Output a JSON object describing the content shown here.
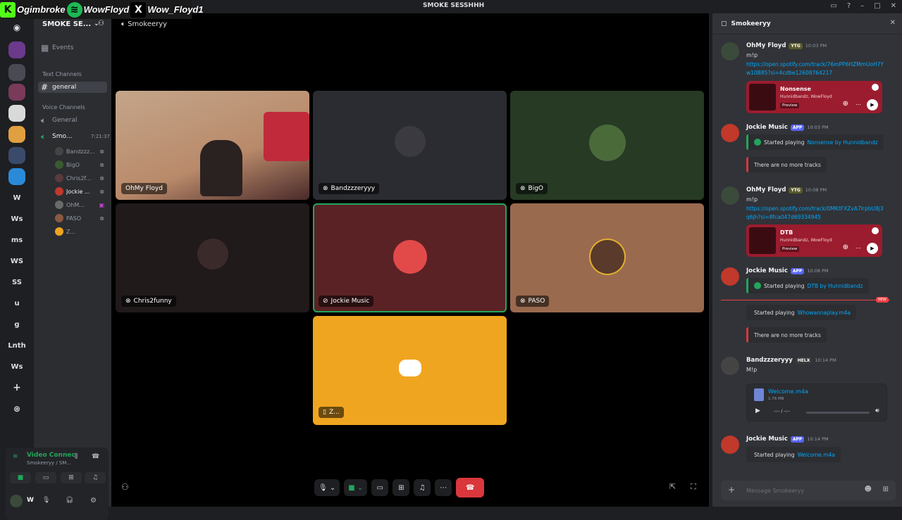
{
  "window": {
    "title": "SMOKE SESSHHH"
  },
  "overlay": [
    {
      "icon": "kick-icon",
      "text": "Ogimbroke"
    },
    {
      "icon": "spotify-icon",
      "text": "WowFloyd"
    },
    {
      "icon": "x-icon",
      "text": "Wow_Floyd1"
    }
  ],
  "servers": {
    "labels": [
      "W",
      "Ws",
      "ms",
      "WS",
      "SS",
      "u",
      "g",
      "Lnth",
      "Ws"
    ]
  },
  "sidebar": {
    "server_name": "SMOKE SE...",
    "events": "Events",
    "text_category": "Text Channels",
    "general_text": "general",
    "voice_category": "Voice Channels",
    "general_voice": "General",
    "active_voice": "Smo...",
    "active_voice_time": "7:21:37",
    "voice_users": [
      "Bandzzz...",
      "BigO",
      "Chris2f...",
      "Jockie ...",
      "OhM...",
      "PASO",
      "Z..."
    ]
  },
  "userpanel": {
    "status": "Video Connec",
    "sub": "Smokeeryy / SM...",
    "user": "W"
  },
  "stage": {
    "title": "Smokeeryy",
    "tiles": [
      {
        "name": "OhMy Floyd",
        "bg": "#8a6a55"
      },
      {
        "name": "Bandzzzeryyy",
        "bg": "#2b2c31"
      },
      {
        "name": "BigO",
        "bg": "#273a24"
      },
      {
        "name": "Chris2funny",
        "bg": "#201a1b"
      },
      {
        "name": "Jockie Music",
        "bg": "#5a2225"
      },
      {
        "name": "PASO",
        "bg": "#9a6a4f"
      },
      {
        "name": "Z...",
        "bg": "#f0a520"
      }
    ]
  },
  "chat": {
    "title": "Smokeeryy",
    "messages": [
      {
        "name": "OhMy Floyd",
        "tag": "YTG",
        "time": "10:03 PM",
        "text": "m!p",
        "link": "https://open.spotify.com/track/76mPP6HZMmUoH7Yw10B85?si=4cdbe12608764217"
      },
      {
        "spotify_title": "Nonsense",
        "spotify_artists": "Hunnidbandz, WowFloyd",
        "preview": "Preview"
      },
      {
        "name": "Jockie Music",
        "tag": "APP",
        "time": "10:03 PM",
        "embed1_pre": "Started playing",
        "embed1_hl": "Nonsense by Hunnidbandz",
        "embed2": "There are no more tracks"
      },
      {
        "name": "OhMy Floyd",
        "tag": "YTG",
        "time": "10:08 PM",
        "text": "m!p",
        "link": "https://open.spotify.com/track/0MKtFXZvA7IrpbU8j3q6jh?si=8fca047d69334945"
      },
      {
        "spotify_title": "DTB",
        "spotify_artists": "Hunnidbandz, WowFloyd",
        "preview": "Preview"
      },
      {
        "name": "Jockie Music",
        "tag": "APP",
        "time": "10:08 PM",
        "embed1_pre": "Started playing",
        "embed1_hl": "DTB by Hunnidbandz",
        "embed2_pre": "Started playing",
        "embed2_hl": "Whowannaplay.m4a",
        "embed3": "There are no more tracks"
      },
      {
        "name": "Bandzzzeryyy",
        "tag": "HELX",
        "time": "10:14 PM",
        "text": "M!p",
        "file_name": "Welcome.m4a",
        "file_size": "1.76 MB",
        "file_time": "-:-- / -:--"
      },
      {
        "name": "Jockie Music",
        "tag": "APP",
        "time": "10:14 PM",
        "embed1_pre": "Started playing",
        "embed1_hl": "Welcome.m4a"
      }
    ],
    "new_badge": "NEW",
    "input_placeholder": "Message Smokeeryy"
  }
}
